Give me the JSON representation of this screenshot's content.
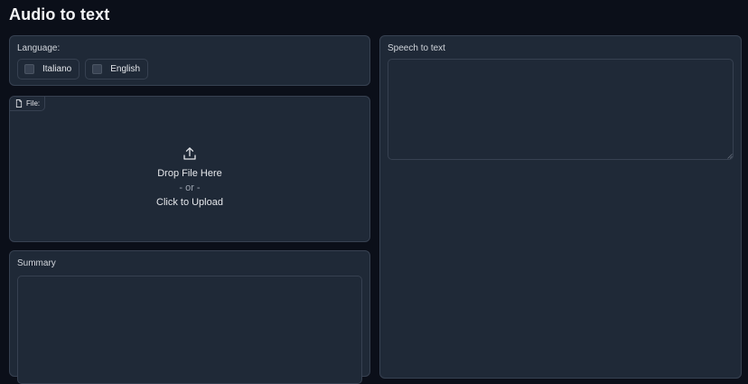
{
  "page": {
    "title": "Audio to text"
  },
  "language": {
    "label": "Language:",
    "options": [
      {
        "label": "Italiano",
        "checked": false
      },
      {
        "label": "English",
        "checked": false
      }
    ]
  },
  "file": {
    "tag_label": "File:",
    "drop_text": "Drop File Here",
    "or_text": "- or -",
    "click_text": "Click to Upload",
    "tag_icon": "file-icon",
    "upload_icon": "upload-icon"
  },
  "summary": {
    "label": "Summary",
    "value": ""
  },
  "speech_to_text": {
    "label": "Speech to text",
    "value": ""
  },
  "colors": {
    "background": "#0b0f19",
    "panel": "#1f2937",
    "border": "#374151",
    "text": "#e5e7eb"
  }
}
